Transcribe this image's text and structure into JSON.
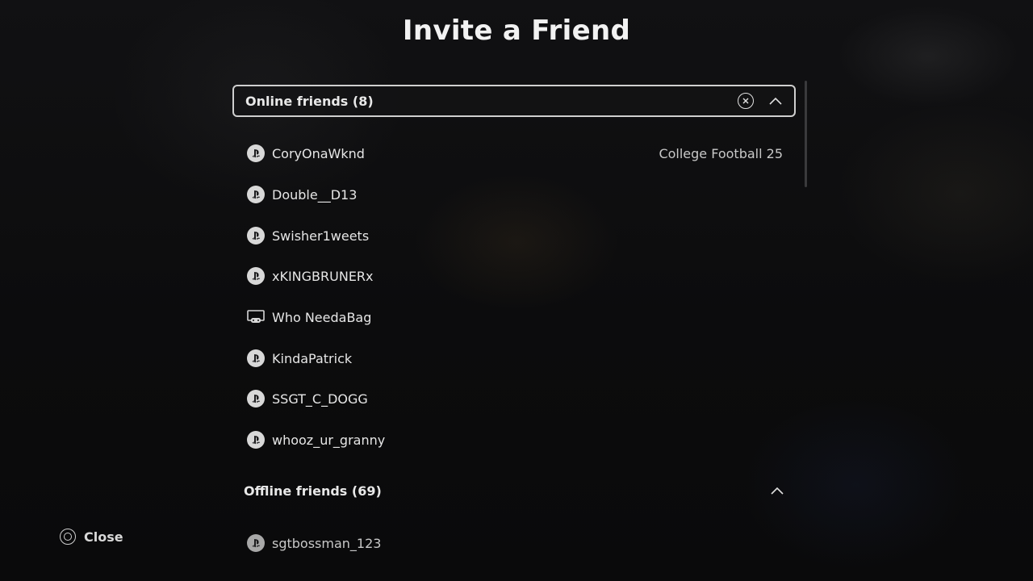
{
  "dialog": {
    "title": "Invite a Friend"
  },
  "online_section": {
    "label": "Online friends (8)",
    "friends": [
      {
        "name": "CoryOnaWknd",
        "platform": "playstation-icon",
        "activity": "College Football 25"
      },
      {
        "name": "Double__D13",
        "platform": "playstation-icon",
        "activity": ""
      },
      {
        "name": "Swisher1weets",
        "platform": "playstation-icon",
        "activity": ""
      },
      {
        "name": "xKINGBRUNERx",
        "platform": "playstation-icon",
        "activity": ""
      },
      {
        "name": "Who NeedaBag",
        "platform": "pc-icon",
        "activity": ""
      },
      {
        "name": "KindaPatrick",
        "platform": "playstation-icon",
        "activity": ""
      },
      {
        "name": "SSGT_C_DOGG",
        "platform": "playstation-icon",
        "activity": ""
      },
      {
        "name": "whooz_ur_granny",
        "platform": "playstation-icon",
        "activity": ""
      }
    ]
  },
  "offline_section": {
    "label": "Offline friends (69)",
    "friends": [
      {
        "name": "sgtbossman_123",
        "platform": "playstation-icon"
      }
    ]
  },
  "footer": {
    "close_label": "Close",
    "close_icon": "circle-button-icon"
  },
  "colors": {
    "background": "#0b0b0c",
    "text": "#e6e6e6",
    "focus_border": "#cfcfcf"
  }
}
